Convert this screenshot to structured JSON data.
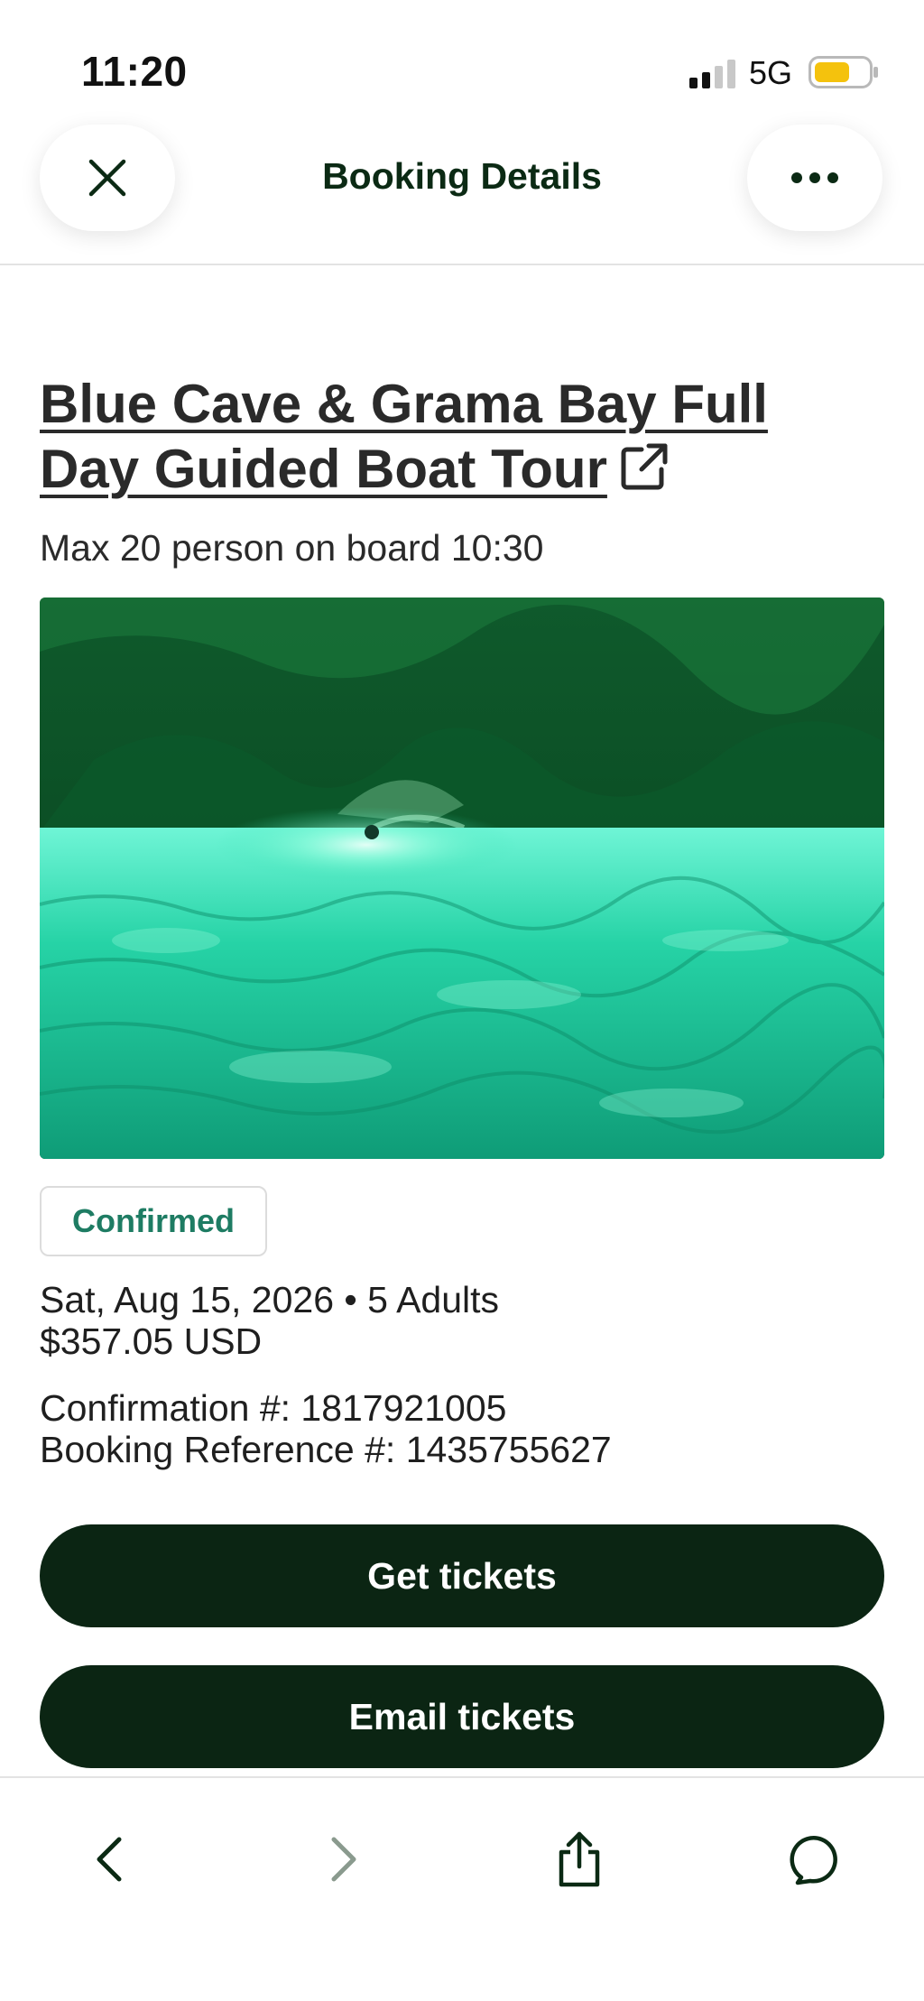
{
  "status_bar": {
    "time": "11:20",
    "network": "5G",
    "battery_color": "#f4c20d"
  },
  "header": {
    "title": "Booking Details",
    "close_icon": "close-icon",
    "more_icon": "more-horizontal-icon"
  },
  "tour": {
    "title": "Blue Cave & Grama Bay Full Day Guided Boat Tour",
    "title_icon": "external-link-icon",
    "subtitle": "Max 20 person on board 10:30"
  },
  "booking": {
    "status": "Confirmed",
    "date_guests": "Sat, Aug 15, 2026 • 5 Adults",
    "price": "$357.05 USD",
    "confirmation": "Confirmation #: 1817921005",
    "reference": "Booking Reference #: 1435755627"
  },
  "actions": {
    "get_tickets": "Get tickets",
    "email_tickets": "Email tickets"
  },
  "browser_toolbar": {
    "icons": [
      "back-icon",
      "forward-icon",
      "share-icon",
      "chat-icon"
    ]
  },
  "colors": {
    "brand_dark": "#0b2513",
    "status_green": "#1e7c63",
    "header_title": "#0b2a14"
  }
}
